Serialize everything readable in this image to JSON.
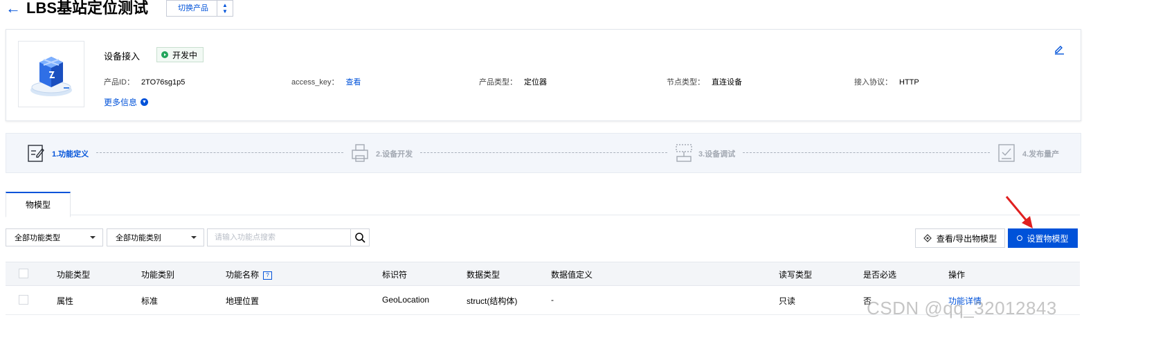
{
  "header": {
    "back_icon": "←",
    "title": "LBS基站定位测试",
    "switch_label": "切换产品"
  },
  "product": {
    "name": "设备接入",
    "status": "开发中",
    "fields": [
      {
        "label": "产品ID：",
        "value": "2TO76sg1p5"
      },
      {
        "label": "access_key：",
        "link": "查看"
      },
      {
        "label": "产品类型：",
        "value": "定位器"
      },
      {
        "label": "节点类型：",
        "value": "直连设备"
      },
      {
        "label": "接入协议：",
        "value": "HTTP"
      }
    ],
    "more": "更多信息"
  },
  "steps": [
    {
      "label": "1.功能定义",
      "active": true
    },
    {
      "label": "2.设备开发",
      "active": false
    },
    {
      "label": "3.设备调试",
      "active": false
    },
    {
      "label": "4.发布量产",
      "active": false
    }
  ],
  "tabs": [
    "物模型"
  ],
  "filters": {
    "type": "全部功能类型",
    "category": "全部功能类别",
    "search_placeholder": "请输入功能点搜索"
  },
  "actions": {
    "view_export": "查看/导出物模型",
    "set_model": "设置物模型"
  },
  "table": {
    "headers": [
      "功能类型",
      "功能类别",
      "功能名称",
      "标识符",
      "数据类型",
      "数据值定义",
      "读写类型",
      "是否必选",
      "操作"
    ],
    "rows": [
      {
        "type": "属性",
        "category": "标准",
        "name": "地理位置",
        "identifier": "GeoLocation",
        "data_type": "struct(结构体)",
        "definition": "-",
        "rw": "只读",
        "required": "否",
        "op": "功能详情"
      }
    ]
  },
  "watermark": "CSDN @qq_32012843",
  "colors": {
    "accent": "#0052d9",
    "status": "#21a45b",
    "arrow": "#e02020"
  }
}
